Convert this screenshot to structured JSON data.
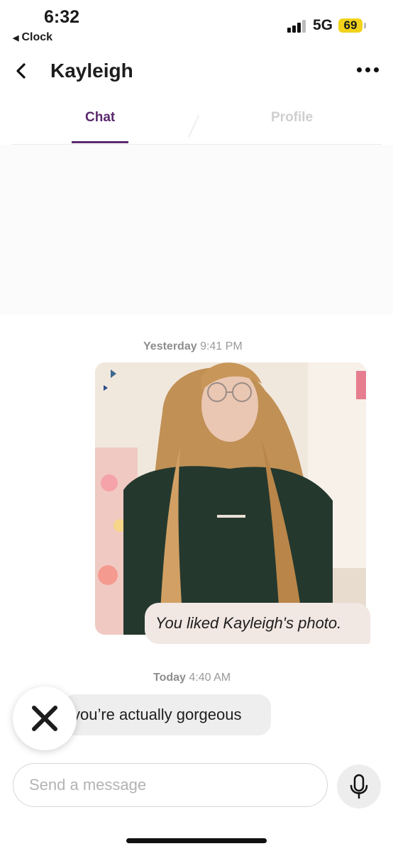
{
  "status_bar": {
    "time": "6:32",
    "back_app": "Clock",
    "network": "5G",
    "battery": "69"
  },
  "header": {
    "title": "Kayleigh",
    "back_icon": "chevron-left-icon",
    "more_icon": "more-dots-icon"
  },
  "tabs": [
    {
      "label": "Chat",
      "active": true
    },
    {
      "label": "Profile",
      "active": false
    }
  ],
  "messages": {
    "stamp1_day": "Yesterday",
    "stamp1_time": "9:41 PM",
    "liked_photo_text": "You liked Kayleigh's photo.",
    "stamp2_day": "Today",
    "stamp2_time": "4:40 AM",
    "incoming_text": "you’re actually gorgeous"
  },
  "composer": {
    "placeholder": "Send a message",
    "mic_icon": "microphone-icon"
  },
  "colors": {
    "accent": "#5b2a6e",
    "battery": "#f2d21b",
    "like_bubble": "#f1e7e3",
    "incoming_bubble": "#eeeeee"
  }
}
